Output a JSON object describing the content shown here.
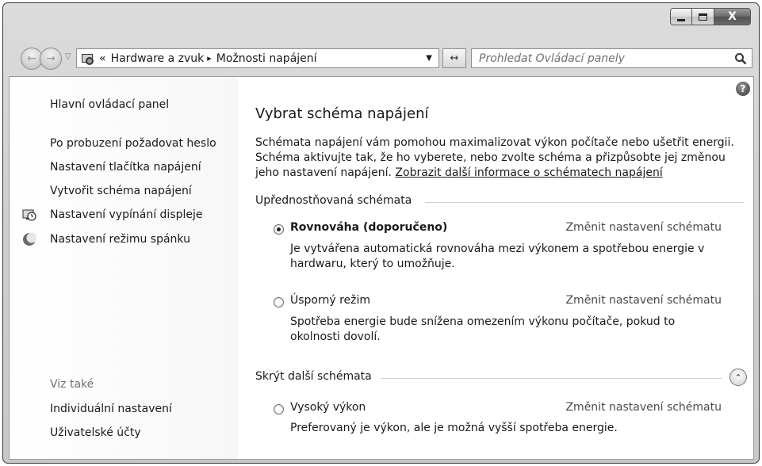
{
  "window": {
    "minimize_label": "",
    "maximize_label": "",
    "close_label": "X"
  },
  "nav": {
    "back_glyph": "←",
    "forward_glyph": "→",
    "recent_glyph": "▽"
  },
  "address": {
    "prefix_glyph": "«",
    "crumb1": "Hardware a zvuk",
    "separator": "▸",
    "crumb2": "Možnosti napájení",
    "dropdown_glyph": "▼",
    "refresh_glyph": "↔"
  },
  "search": {
    "placeholder": "Prohledat Ovládací panely"
  },
  "sidebar": {
    "home": "Hlavní ovládací panel",
    "items": [
      "Po probuzení požadovat heslo",
      "Nastavení tlačítka napájení",
      "Vytvořit schéma napájení",
      "Nastavení vypínání displeje",
      "Nastavení režimu spánku"
    ],
    "see_also_heading": "Viz také",
    "see_also": [
      "Individuální nastavení",
      "Uživatelské účty"
    ]
  },
  "main": {
    "help_glyph": "?",
    "title": "Vybrat schéma napájení",
    "description": "Schémata napájení vám pomohou maximalizovat výkon počítače nebo ušetřit energii. Schéma aktivujte tak, že ho vyberete, nebo zvolte schéma a přizpůsobte jej změnou jeho nastavení napájení.",
    "more_info_link": "Zobrazit další informace o schématech napájení",
    "preferred_group": "Upřednostňovaná schémata",
    "hidden_group": "Skrýt další schémata",
    "collapse_glyph": "⌃",
    "change_label": "Změnit nastavení schématu",
    "plans": [
      {
        "name": "Rovnováha (doporučeno)",
        "selected": true,
        "description": "Je vytvářena automatická rovnováha mezi výkonem a spotřebou energie v hardwaru, který to umožňuje."
      },
      {
        "name": "Úsporný režim",
        "selected": false,
        "description": "Spotřeba energie bude snížena omezením výkonu počítače, pokud to okolnosti dovolí."
      },
      {
        "name": "Vysoký výkon",
        "selected": false,
        "description": "Preferovaný je výkon, ale je možná vyšší spotřeba energie."
      }
    ]
  }
}
